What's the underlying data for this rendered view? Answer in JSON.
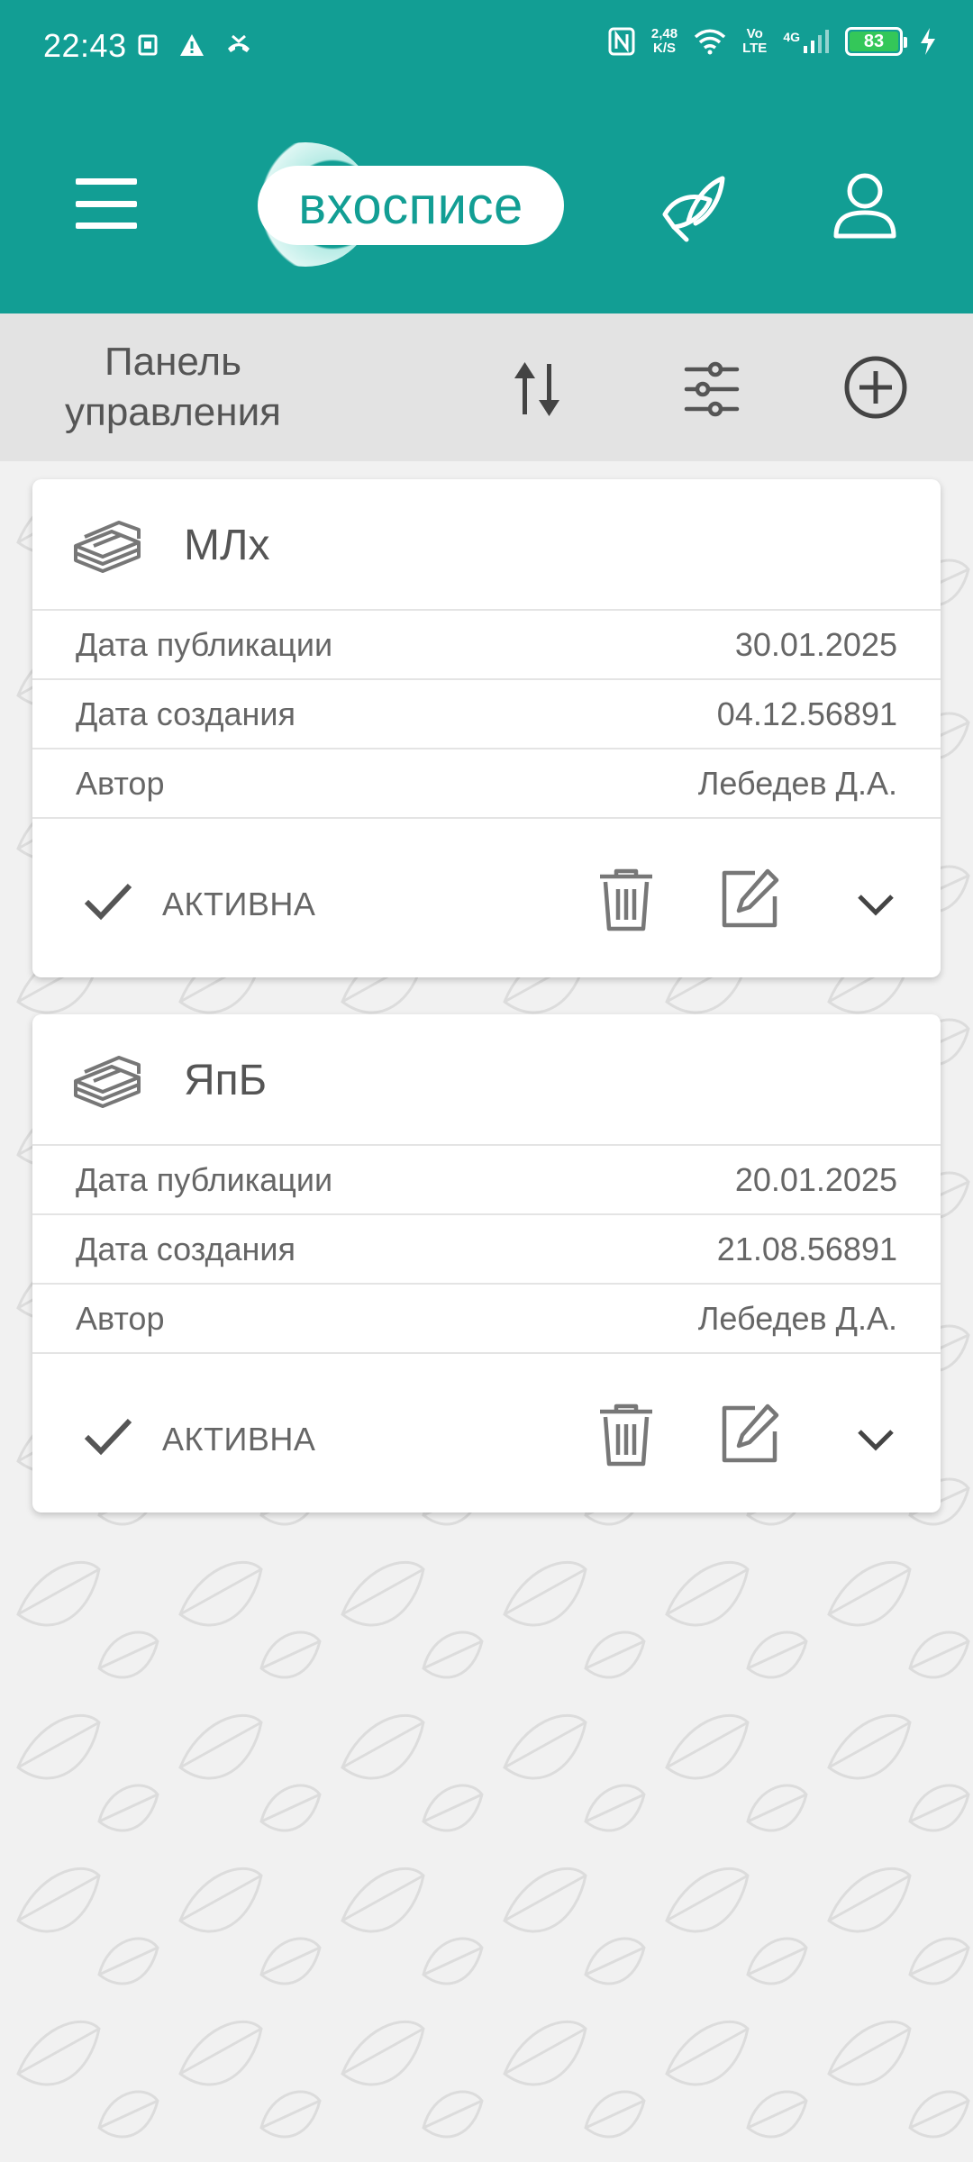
{
  "status_bar": {
    "time": "22:43",
    "net_speed_value": "2,48",
    "net_speed_unit": "K/S",
    "volte_top": "Vo",
    "volte_bottom": "LTE",
    "network": "4G",
    "battery": "83"
  },
  "header": {
    "logo_text": "вхосписе",
    "icons": [
      "menu-icon",
      "feather-icon",
      "user-icon"
    ]
  },
  "toolbar": {
    "title": "Панель управления",
    "icons": [
      "sort-icon",
      "filter-icon",
      "add-circle-icon"
    ]
  },
  "cards": [
    {
      "title": "МЛх",
      "rows": [
        {
          "label": "Дата публикации",
          "value": "30.01.2025"
        },
        {
          "label": "Дата создания",
          "value": "04.12.56891"
        },
        {
          "label": "Автор",
          "value": "Лебедев Д.А."
        }
      ],
      "status": "АКТИВНА"
    },
    {
      "title": "ЯпБ",
      "rows": [
        {
          "label": "Дата публикации",
          "value": "20.01.2025"
        },
        {
          "label": "Дата создания",
          "value": "21.08.56891"
        },
        {
          "label": "Автор",
          "value": "Лебедев Д.А."
        }
      ],
      "status": "АКТИВНА"
    }
  ],
  "colors": {
    "primary": "#129e94",
    "toolbar_bg": "#e3e3e3",
    "page_bg": "#f1f1f1",
    "battery": "#34c759"
  }
}
